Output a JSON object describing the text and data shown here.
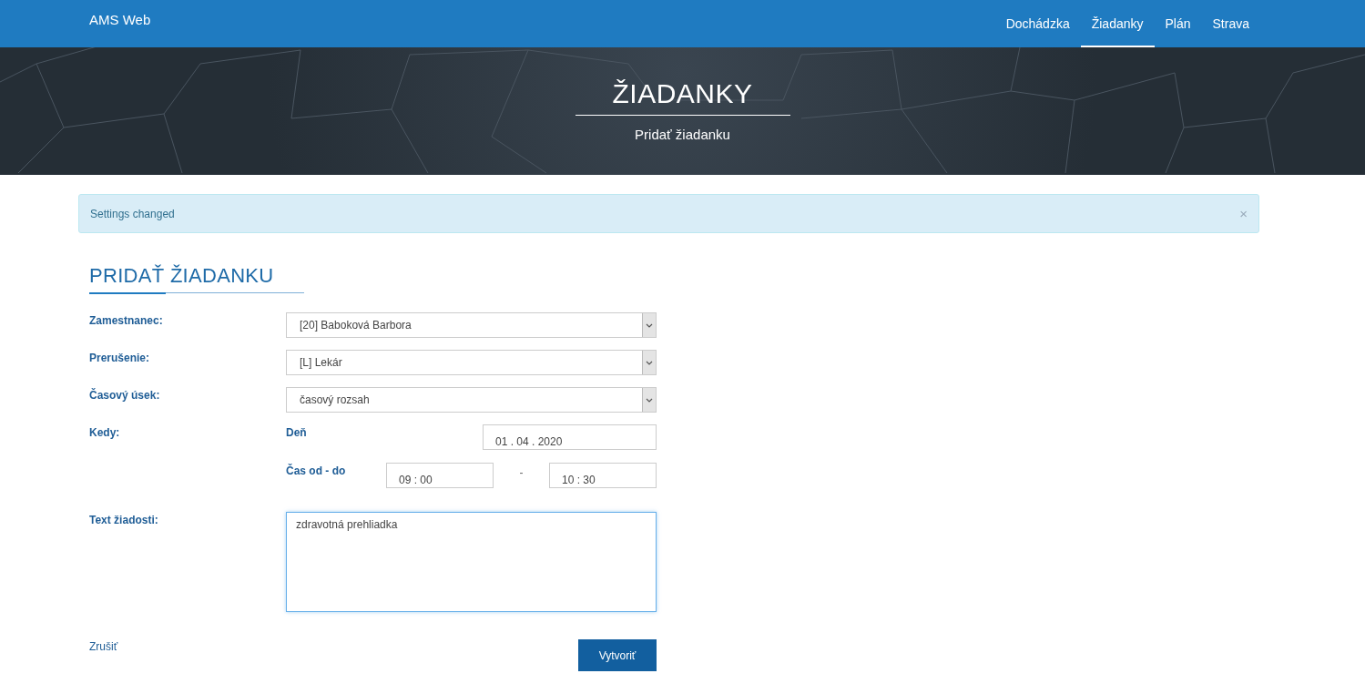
{
  "navbar": {
    "brand": "AMS Web",
    "items": [
      {
        "label": "Dochádzka",
        "selected": false
      },
      {
        "label": "Žiadanky",
        "selected": true
      },
      {
        "label": "Plán",
        "selected": false
      },
      {
        "label": "Strava",
        "selected": false
      }
    ]
  },
  "hero": {
    "title": "ŽIADANKY",
    "subtitle": "Pridať žiadanku"
  },
  "alert": {
    "message": "Settings changed",
    "close": "×"
  },
  "form": {
    "title": "PRIDAŤ ŽIADANKU",
    "selects": [
      {
        "label": "Zamestnanec:",
        "value": "[20] Baboková Barbora"
      },
      {
        "label": "Prerušenie:",
        "value": "[L] Lekár"
      },
      {
        "label": "Časový úsek:",
        "value": "časový rozsah"
      }
    ],
    "when": {
      "label": "Kedy:",
      "day_label": "Deň",
      "day_value": "01 . 04 . 2020",
      "time_label": "Čas od - do",
      "time_from": "09 : 00",
      "separator": "-",
      "time_to": "10 : 30"
    },
    "request_text": {
      "label": "Text žiadosti:",
      "value": "zdravotná prehliadka",
      "focused": true
    },
    "cancel": "Zrušiť",
    "submit": "Vytvoriť"
  }
}
